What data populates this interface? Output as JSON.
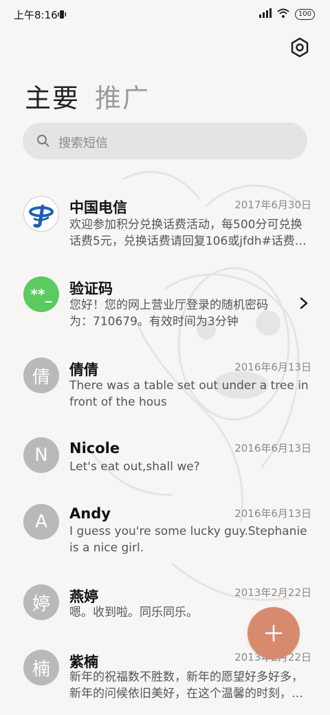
{
  "status_bar": {
    "time": "上午8:16",
    "battery": "100"
  },
  "tabs": [
    {
      "label": "主要"
    },
    {
      "label": "推广"
    }
  ],
  "search": {
    "placeholder": "搜索短信"
  },
  "conversations": [
    {
      "name": "中国电信",
      "date": "2017年6月30日",
      "preview": "欢迎参加积分兑换话费活动，每500分可兑换话费5元，兑换话费请回复106或jfdh#话费…",
      "avatar_type": "telecom-logo"
    },
    {
      "name": "验证码",
      "date": "",
      "preview": "您好！您的网上营业厅登录的随机密码为：710679。有效时间为3分钟",
      "avatar_text": "**_",
      "avatar_color": "#5ccb5f"
    },
    {
      "name": "倩倩",
      "date": "2016年6月13日",
      "preview": "There was a table set out under a tree in front of the hous",
      "avatar_text": "倩"
    },
    {
      "name": "Nicole",
      "date": "2016年6月13日",
      "preview": "Let's eat out,shall we?",
      "avatar_text": "N"
    },
    {
      "name": "Andy",
      "date": "2016年6月13日",
      "preview": "I guess you're some lucky guy.Stephanie is a nice girl.",
      "avatar_text": "A"
    },
    {
      "name": "燕婷",
      "date": "2013年2月22日",
      "preview": "嗯。收到啦。同乐同乐。",
      "avatar_text": "婷"
    },
    {
      "name": "紫楠",
      "date": "2013年2月22日",
      "preview": "新年的祝福数不胜数，新年的愿望好多好多，新年的问候依旧美好，在这个温馨的时刻，…",
      "avatar_text": "楠"
    }
  ],
  "colors": {
    "fab": "#d88a6e",
    "avatar_gray": "#b9b9b9",
    "verify_green": "#5ccb5f",
    "telecom_blue": "#1d5fb5"
  }
}
